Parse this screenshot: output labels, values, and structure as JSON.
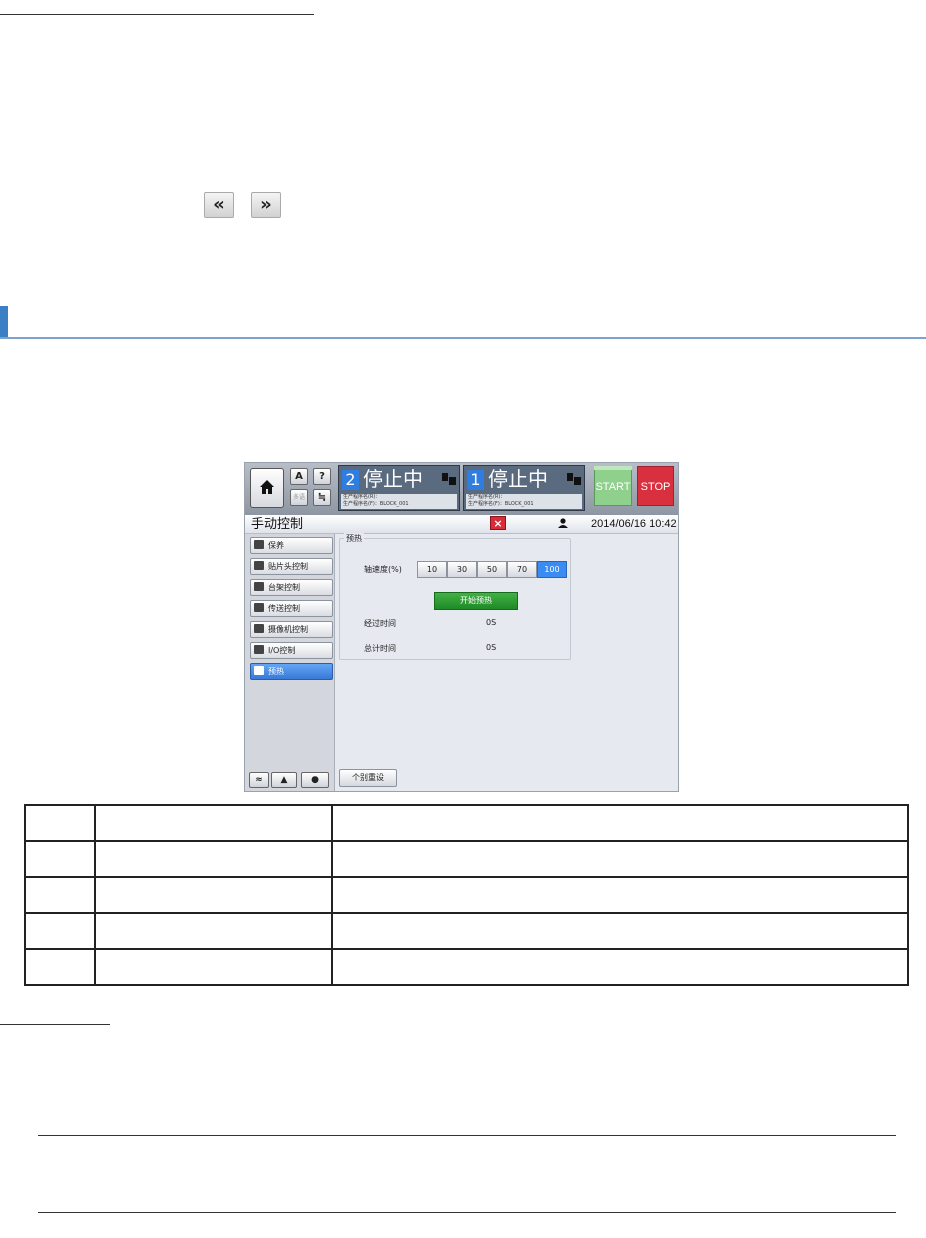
{
  "nav": {
    "prev_label": "«",
    "next_label": "»"
  },
  "app": {
    "home_icon": "home-icon",
    "top_small_buttons": [
      {
        "label": "A",
        "icon": "manual-icon"
      },
      {
        "label": "?",
        "icon": "help-icon"
      },
      {
        "label": "多语",
        "icon": "language-icon"
      },
      {
        "label": "≒",
        "icon": "network-icon"
      }
    ],
    "panels": [
      {
        "number": "2",
        "state": "停止中",
        "info_line1": "生产程序名(R)：",
        "info_line2": "生产程序名(F)：BLOCK_001"
      },
      {
        "number": "1",
        "state": "停止中",
        "info_line1": "生产程序名(R)：",
        "info_line2": "生产程序名(F)：BLOCK_001"
      }
    ],
    "start_label": "START",
    "stop_label": "STOP",
    "title": "手动控制",
    "close_label": "×",
    "datetime": "2014/06/16 10:42",
    "sidebar": [
      {
        "label": "保养",
        "icon": "maintenance-icon",
        "active": false
      },
      {
        "label": "贴片头控制",
        "icon": "head-control-icon",
        "active": false
      },
      {
        "label": "台架控制",
        "icon": "table-control-icon",
        "active": false
      },
      {
        "label": "传送控制",
        "icon": "conveyor-icon",
        "active": false
      },
      {
        "label": "摄像机控制",
        "icon": "camera-icon",
        "active": false
      },
      {
        "label": "I/O控制",
        "icon": "io-icon",
        "active": false
      },
      {
        "label": "预热",
        "icon": "preheat-icon",
        "active": true
      }
    ],
    "bottom_icons": [
      {
        "label": "≈",
        "name": "collapse-icon"
      },
      {
        "label": "▲",
        "name": "warning-icon"
      },
      {
        "label": "●",
        "name": "info-icon"
      }
    ],
    "preheat": {
      "group_title": "预热",
      "speed_label": "轴速度(%)",
      "speeds": [
        "10",
        "30",
        "50",
        "70",
        "100"
      ],
      "selected_speed": "100",
      "start_button": "开始预热",
      "elapsed_label": "经过时间",
      "elapsed_value": "0S",
      "total_label": "总计时间",
      "total_value": "0S"
    },
    "reset_button": "个别重设",
    "colors": {
      "start": "#8ed08c",
      "stop": "#d9303f",
      "active": "#3b8cf2",
      "preheat_button": "#2a9a30"
    }
  },
  "table": {
    "rows": [
      [
        "",
        "",
        ""
      ],
      [
        "",
        "",
        ""
      ],
      [
        "",
        "",
        ""
      ],
      [
        "",
        "",
        ""
      ],
      [
        "",
        "",
        ""
      ]
    ]
  }
}
